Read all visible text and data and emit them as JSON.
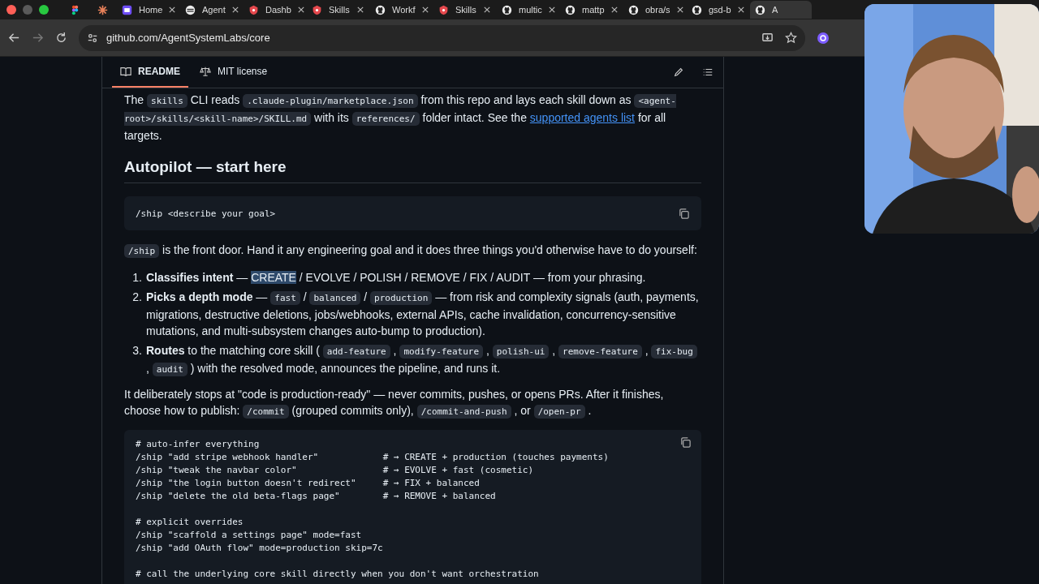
{
  "tabs": [
    {
      "kind": "figma",
      "selected": false
    },
    {
      "kind": "burst",
      "selected": false
    },
    {
      "label": "Home",
      "kind": "square",
      "selected": false
    },
    {
      "label": "Agent",
      "kind": "circle",
      "selected": false
    },
    {
      "label": "Dashb",
      "kind": "shield",
      "selected": false
    },
    {
      "label": "Skills",
      "kind": "shield",
      "selected": false
    },
    {
      "label": "Workf",
      "kind": "github",
      "selected": false
    },
    {
      "label": "Skills",
      "kind": "shield",
      "selected": false
    },
    {
      "label": "multic",
      "kind": "github",
      "selected": false
    },
    {
      "label": "mattp",
      "kind": "github",
      "selected": false
    },
    {
      "label": "obra/s",
      "kind": "github",
      "selected": false
    },
    {
      "label": "gsd-b",
      "kind": "github",
      "selected": false
    },
    {
      "label": "A",
      "kind": "github",
      "selected": true
    }
  ],
  "address": "github.com/AgentSystemLabs/core",
  "readme_tabs": [
    {
      "label": "README",
      "selected": true
    },
    {
      "label": "MIT license",
      "selected": false
    }
  ],
  "intro": [
    {
      "kind": "text",
      "text": "The "
    },
    {
      "kind": "code",
      "text": "skills"
    },
    {
      "kind": "text",
      "text": " CLI reads "
    },
    {
      "kind": "code",
      "text": ".claude-plugin/marketplace.json"
    },
    {
      "kind": "text",
      "text": " from this repo and lays each skill down as "
    },
    {
      "kind": "code",
      "text": "<agent-root>/skills/<skill-name>/SKILL.md"
    },
    {
      "kind": "text",
      "text": " with its "
    },
    {
      "kind": "code",
      "text": "references/"
    },
    {
      "kind": "text",
      "text": " folder intact. See the "
    },
    {
      "kind": "link",
      "text": "supported agents list"
    },
    {
      "kind": "text",
      "text": " for all targets."
    }
  ],
  "heading": "Autopilot — start here",
  "command": "/ship <describe your goal>",
  "lead": [
    {
      "kind": "code",
      "text": "/ship"
    },
    {
      "kind": "text",
      "text": " is the front door. Hand it any engineering goal and it does three things you'd otherwise have to do yourself:"
    }
  ],
  "steps": [
    {
      "marker": "1.",
      "parts": [
        {
          "kind": "bold",
          "text": "Classifies intent"
        },
        {
          "kind": "text",
          "text": " — "
        },
        {
          "kind": "highlight",
          "text": "CREATE"
        },
        {
          "kind": "text",
          "text": " / EVOLVE / POLISH / REMOVE / FIX / AUDIT — from your phrasing."
        }
      ]
    },
    {
      "marker": "2.",
      "parts": [
        {
          "kind": "bold",
          "text": "Picks a depth mode"
        },
        {
          "kind": "text",
          "text": " — "
        },
        {
          "kind": "code",
          "text": "fast"
        },
        {
          "kind": "text",
          "text": " / "
        },
        {
          "kind": "code",
          "text": "balanced"
        },
        {
          "kind": "text",
          "text": " / "
        },
        {
          "kind": "code",
          "text": "production"
        },
        {
          "kind": "text",
          "text": " — from risk and complexity signals (auth, payments, migrations, destructive deletions, jobs/webhooks, external APIs, cache invalidation, concurrency-sensitive mutations, and multi-subsystem changes auto-bump to production)."
        }
      ]
    },
    {
      "marker": "3.",
      "parts": [
        {
          "kind": "bold",
          "text": "Routes"
        },
        {
          "kind": "text",
          "text": " to the matching core skill ( "
        },
        {
          "kind": "code",
          "text": "add-feature"
        },
        {
          "kind": "text",
          "text": " , "
        },
        {
          "kind": "code",
          "text": "modify-feature"
        },
        {
          "kind": "text",
          "text": " , "
        },
        {
          "kind": "code",
          "text": "polish-ui"
        },
        {
          "kind": "text",
          "text": " , "
        },
        {
          "kind": "code",
          "text": "remove-feature"
        },
        {
          "kind": "text",
          "text": " , "
        },
        {
          "kind": "code",
          "text": "fix-bug"
        },
        {
          "kind": "text",
          "text": " , "
        },
        {
          "kind": "code",
          "text": "audit"
        },
        {
          "kind": "text",
          "text": " ) with the resolved mode, announces the pipeline, and runs it."
        }
      ]
    }
  ],
  "outro": [
    {
      "kind": "text",
      "text": "It deliberately stops at \"code is production-ready\" — never commits, pushes, or opens PRs. After it finishes, choose how to publish: "
    },
    {
      "kind": "code",
      "text": "/commit"
    },
    {
      "kind": "text",
      "text": " (grouped commits only), "
    },
    {
      "kind": "code",
      "text": "/commit-and-push"
    },
    {
      "kind": "text",
      "text": " , or "
    },
    {
      "kind": "code",
      "text": "/open-pr"
    },
    {
      "kind": "text",
      "text": " ."
    }
  ],
  "code_groups": [
    [
      "# auto-infer everything",
      "/ship \"add stripe webhook handler\"            # → CREATE + production (touches payments)",
      "/ship \"tweak the navbar color\"                # → EVOLVE + fast (cosmetic)",
      "/ship \"the login button doesn't redirect\"     # → FIX + balanced",
      "/ship \"delete the old beta-flags page\"        # → REMOVE + balanced"
    ],
    [
      "# explicit overrides",
      "/ship \"scaffold a settings page\" mode=fast",
      "/ship \"add OAuth flow\" mode=production skip=7c"
    ],
    [
      "# call the underlying core skill directly when you don't want orchestration"
    ]
  ],
  "webcam": {
    "kind": "picture"
  }
}
